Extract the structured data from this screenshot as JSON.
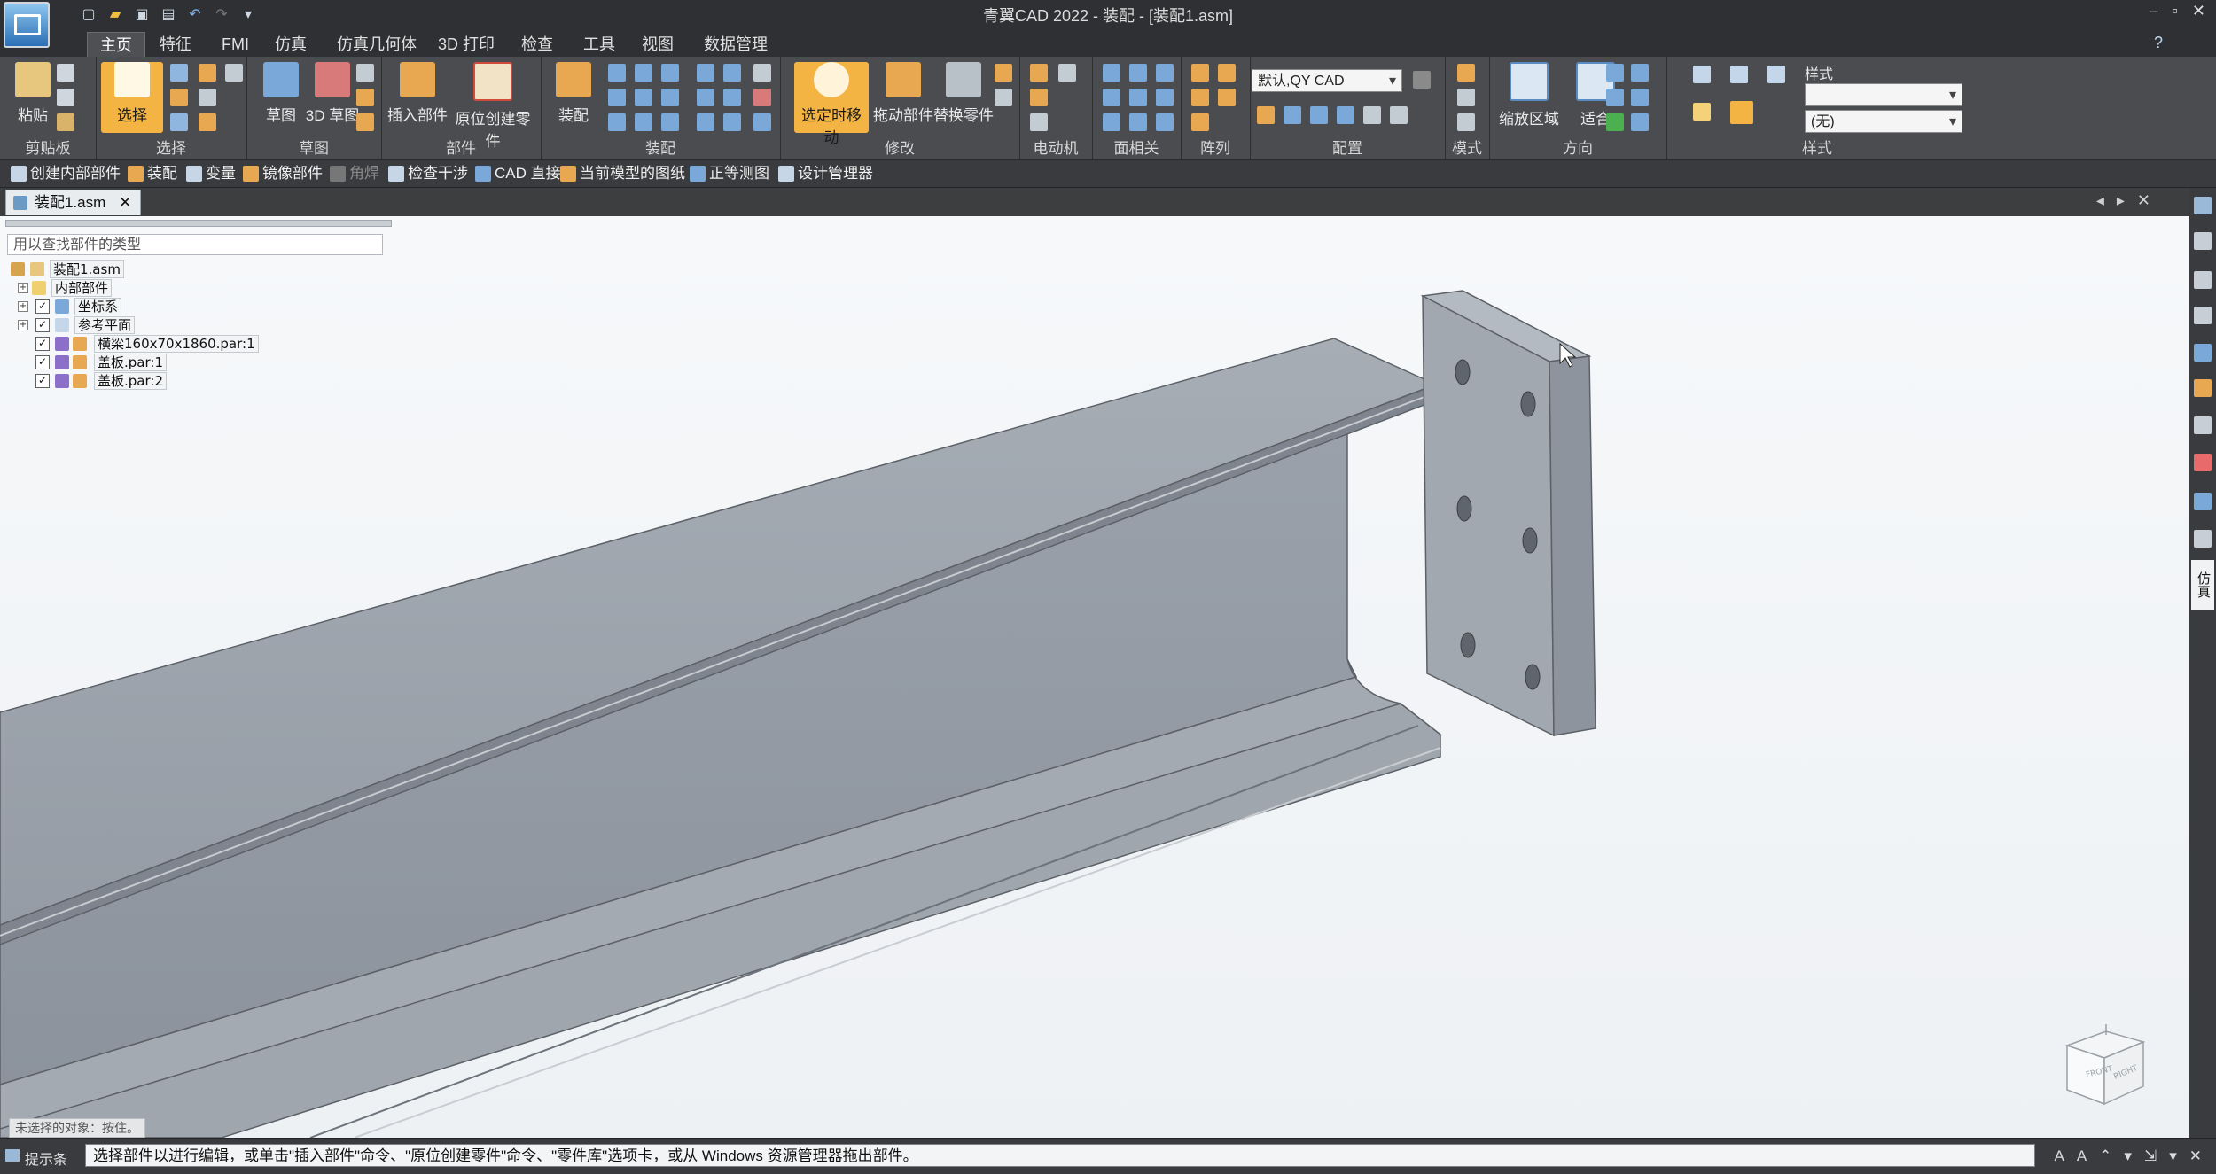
{
  "app": {
    "window_title": "青翼CAD 2022 - 装配 - [装配1.asm]",
    "window_controls": [
      "–",
      "▫",
      "✕"
    ]
  },
  "quick_access": [
    "new-icon",
    "open-icon",
    "save-icon",
    "save-all-icon",
    "undo-icon",
    "redo-icon",
    "customize-icon"
  ],
  "ribbon": {
    "tabs": [
      "主页",
      "特征",
      "FMI",
      "仿真",
      "仿真几何体",
      "3D 打印",
      "检查",
      "工具",
      "视图",
      "数据管理"
    ],
    "active_tab": "主页",
    "help_label": "?",
    "groups": {
      "clipboard": {
        "label": "剪贴板",
        "paste": "粘贴"
      },
      "select": {
        "label": "选择",
        "select": "选择"
      },
      "sketch": {
        "label": "草图",
        "sketch": "草图",
        "sketch3d": "3D 草图"
      },
      "parts": {
        "label": "部件",
        "insert": "插入部件",
        "create_in_place": "原位创建零件"
      },
      "assemble": {
        "label": "装配",
        "assemble": "装配"
      },
      "modify": {
        "label": "修改",
        "move_selected": "选定时移动",
        "drag_part": "拖动部件",
        "replace_part": "替换零件"
      },
      "motor": {
        "label": "电动机"
      },
      "face_related": {
        "label": "面相关"
      },
      "pattern": {
        "label": "阵列"
      },
      "config": {
        "label": "配置",
        "combo_value": "默认,QY CAD"
      },
      "mode": {
        "label": "模式"
      },
      "orient": {
        "label": "方向",
        "zoom_area": "缩放区域",
        "fit": "适合"
      },
      "style": {
        "label": "样式",
        "style_title": "样式",
        "style_value": "",
        "face_style": "(无)"
      }
    }
  },
  "command_bar": [
    {
      "label": "创建内部部件",
      "icon": "create-internal-icon",
      "disabled": false
    },
    {
      "label": "装配",
      "icon": "assembly-icon",
      "disabled": false
    },
    {
      "label": "变量",
      "icon": "variables-icon",
      "disabled": false
    },
    {
      "label": "镜像部件",
      "icon": "mirror-icon",
      "disabled": false
    },
    {
      "label": "角焊",
      "icon": "fillet-weld-icon",
      "disabled": true
    },
    {
      "label": "检查干涉",
      "icon": "interference-icon",
      "disabled": false
    },
    {
      "label": "CAD 直接",
      "icon": "cad-direct-icon",
      "disabled": false
    },
    {
      "label": "当前模型的图纸",
      "icon": "drawing-icon",
      "disabled": false
    },
    {
      "label": "正等测图",
      "icon": "iso-view-icon",
      "disabled": false
    },
    {
      "label": "设计管理器",
      "icon": "design-manager-icon",
      "disabled": false
    }
  ],
  "document": {
    "tab_label": "装配1.asm",
    "nav": [
      "◂",
      "▸",
      "✕"
    ]
  },
  "pathfinder": {
    "search_placeholder": "用以查找部件的类型",
    "root": "装配1.asm",
    "items": [
      {
        "label": "内部部件",
        "expander": "+",
        "checked": null
      },
      {
        "label": "坐标系",
        "expander": "+",
        "checked": true
      },
      {
        "label": "参考平面",
        "expander": "+",
        "checked": true
      },
      {
        "label": "横梁160x70x1860.par:1",
        "expander": "",
        "checked": true
      },
      {
        "label": "盖板.par:1",
        "expander": "",
        "checked": true
      },
      {
        "label": "盖板.par:2",
        "expander": "",
        "checked": true
      }
    ]
  },
  "viewcube": {
    "face_front": "FRONT",
    "face_right": "RIGHT"
  },
  "viewport_note": "未选择的对象：按住。",
  "right_dock": {
    "buttons": [
      "library-icon",
      "layers-icon",
      "tools-icon",
      "sensor-icon",
      "feature-library-icon",
      "image-icon",
      "camera-icon",
      "help-icon",
      "grid-icon",
      "simulation-icon"
    ],
    "active_label": "仿真"
  },
  "status": {
    "label": "提示条",
    "prompt": "选择部件以进行编辑，或单击\"插入部件\"命令、\"原位创建零件\"命令、\"零件库\"选项卡，或从 Windows 资源管理器拖出部件。",
    "tools": [
      "A",
      "A",
      "⌃",
      "▾",
      "⇲",
      "▾",
      "✕"
    ]
  },
  "colors": {
    "accent": "#f4b443",
    "ribbon_bg": "#4b4c50",
    "viewport_bg": "#f3f5f7",
    "model_face": "#9aa1aa"
  }
}
